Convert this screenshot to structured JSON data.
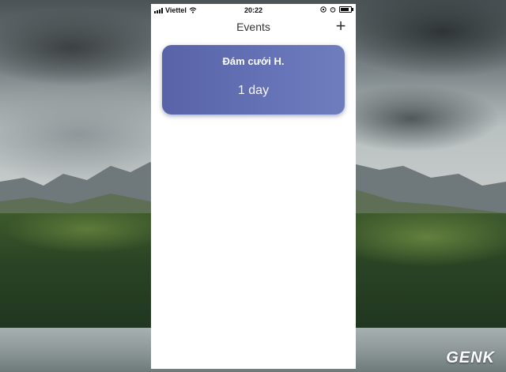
{
  "status_bar": {
    "carrier": "Viettel",
    "time": "20:22"
  },
  "nav": {
    "title": "Events",
    "add_label": "+"
  },
  "events": [
    {
      "title": "Đám cưới H.",
      "countdown": "1 day"
    }
  ],
  "watermark": "GENK",
  "colors": {
    "card_gradient_start": "#5863a8",
    "card_gradient_end": "#6f7dbf",
    "screen_background": "#ffffff"
  },
  "icons": [
    "signal-icon",
    "wifi-icon",
    "orientation-lock-icon",
    "alarm-icon",
    "battery-icon",
    "plus-icon"
  ]
}
